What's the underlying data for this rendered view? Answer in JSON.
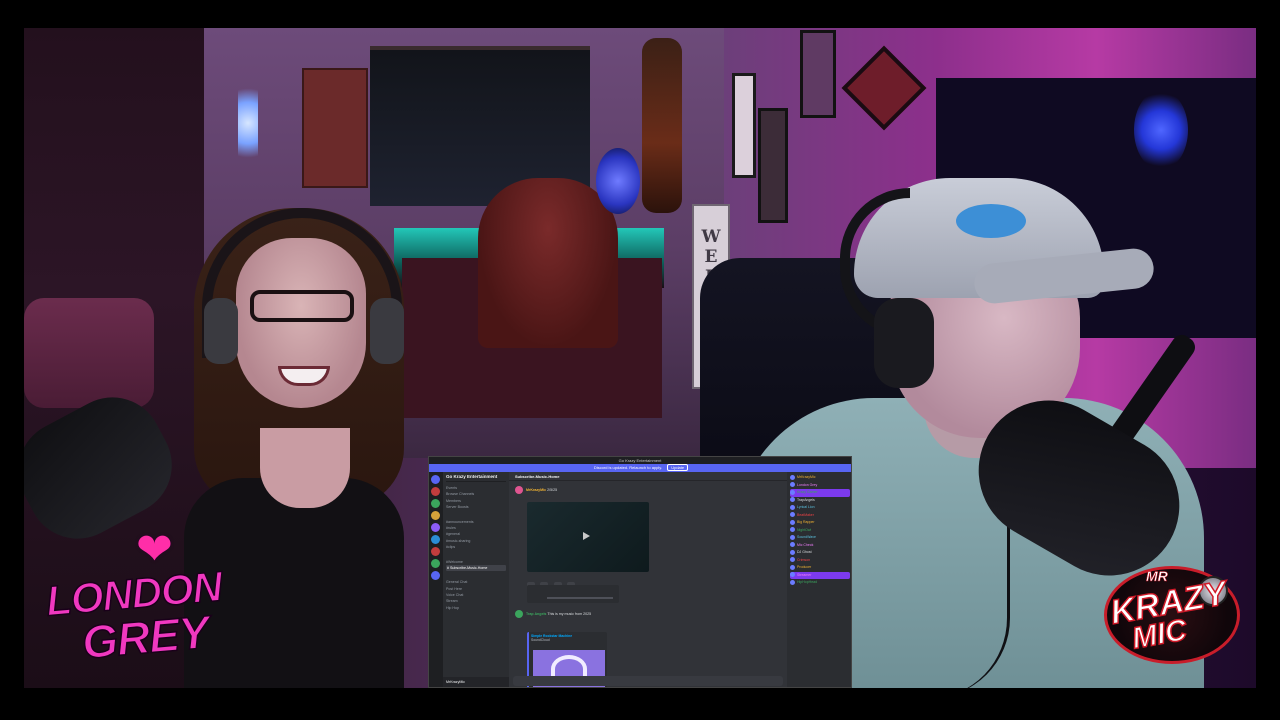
{
  "scene": {
    "description_sign": "WELCOME"
  },
  "logos": {
    "left_line1": "LONDON",
    "left_line2": "GREY",
    "right_line1": "MR",
    "right_line2": "KRAZY",
    "right_line3": "MIC"
  },
  "discord": {
    "window_title": "Go Krazy Entertainment",
    "banner_text": "Discord is updated. Relaunch to apply.",
    "banner_button": "Update",
    "server_name": "Go Krazy Entertainment",
    "channels": [
      {
        "label": "Events",
        "active": false
      },
      {
        "label": "Browse Channels",
        "active": false
      },
      {
        "label": "Members",
        "active": false
      },
      {
        "label": "Server Boosts",
        "active": false
      },
      {
        "label": "#announcements",
        "active": false
      },
      {
        "label": "#rules",
        "active": false
      },
      {
        "label": "#general",
        "active": false
      },
      {
        "label": "#music-sharing",
        "active": false
      },
      {
        "label": "#clips",
        "active": false
      },
      {
        "label": "#Welcome",
        "active": false
      },
      {
        "label": "# Subscribe-Music-Home",
        "active": true
      },
      {
        "label": "General Chat",
        "active": false
      },
      {
        "label": "Post Here",
        "active": false
      },
      {
        "label": "Voice Chat",
        "active": false
      },
      {
        "label": "Stream",
        "active": false
      },
      {
        "label": "Hip Hop",
        "active": false
      }
    ],
    "user_name": "MrKrazyMic",
    "header_channel": "Subscribe-Music-Home",
    "messages": [
      {
        "author": "MrKrazyMic",
        "text": "2/5/25"
      },
      {
        "author": "Trap Angels",
        "text": "This is my music from 2025"
      }
    ],
    "embed": {
      "title": "Simple Rockstar Machine",
      "subtitle": "SoundCloud"
    },
    "members": [
      {
        "name": "MrKrazyMic",
        "style": "m-gold",
        "live": false
      },
      {
        "name": "London Grey",
        "style": "m-pink",
        "live": false
      },
      {
        "name": "Krazy Gamer",
        "style": "m-green",
        "live": true
      },
      {
        "name": "TrapAngels",
        "style": "m-white",
        "live": false
      },
      {
        "name": "Lyrical Lion",
        "style": "m-cyan",
        "live": false
      },
      {
        "name": "BeatMaker",
        "style": "m-red",
        "live": false
      },
      {
        "name": "Big Rapper",
        "style": "m-gold",
        "live": false
      },
      {
        "name": "NightOwl",
        "style": "m-green",
        "live": false
      },
      {
        "name": "SoundWave",
        "style": "m-cyan",
        "live": false
      },
      {
        "name": "Mic Check",
        "style": "m-pink",
        "live": false
      },
      {
        "name": "DJ Ghost",
        "style": "m-white",
        "live": false
      },
      {
        "name": "Crimson",
        "style": "m-red",
        "live": false
      },
      {
        "name": "Producer",
        "style": "m-gold",
        "live": false
      },
      {
        "name": "Streamer",
        "style": "m-pink",
        "live": true
      },
      {
        "name": "HipHopHead",
        "style": "m-green",
        "live": false
      }
    ]
  },
  "colors": {
    "left_logo": "#f038c0",
    "right_logo_accent": "#d01a28",
    "discord_accent": "#5865f2"
  }
}
